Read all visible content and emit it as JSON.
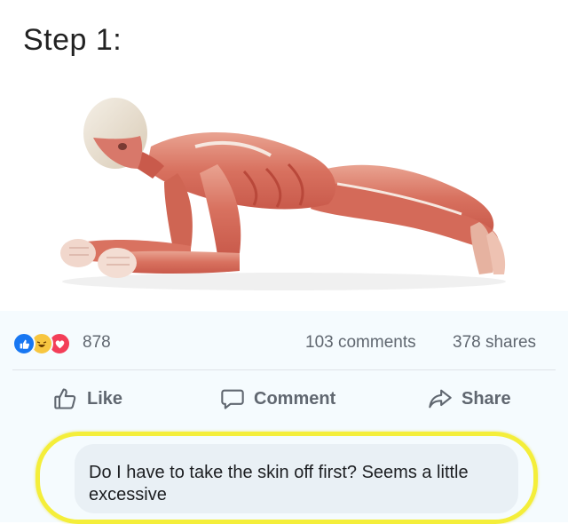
{
  "meme": {
    "step_title": "Step 1:"
  },
  "post": {
    "reactions": {
      "count": "878",
      "icons": [
        "like-icon",
        "haha-icon",
        "love-icon"
      ],
      "colors": {
        "like": "#1877f2",
        "haha": "#f7c640",
        "love": "#f33e58"
      }
    },
    "comments_count": "103 comments",
    "shares_count": "378 shares",
    "actions": {
      "like_label": "Like",
      "comment_label": "Comment",
      "share_label": "Share"
    },
    "comment": {
      "text": "Do I have to take the skin off first? Seems a little excessive",
      "highlight_color": "#f4ee3a"
    }
  }
}
